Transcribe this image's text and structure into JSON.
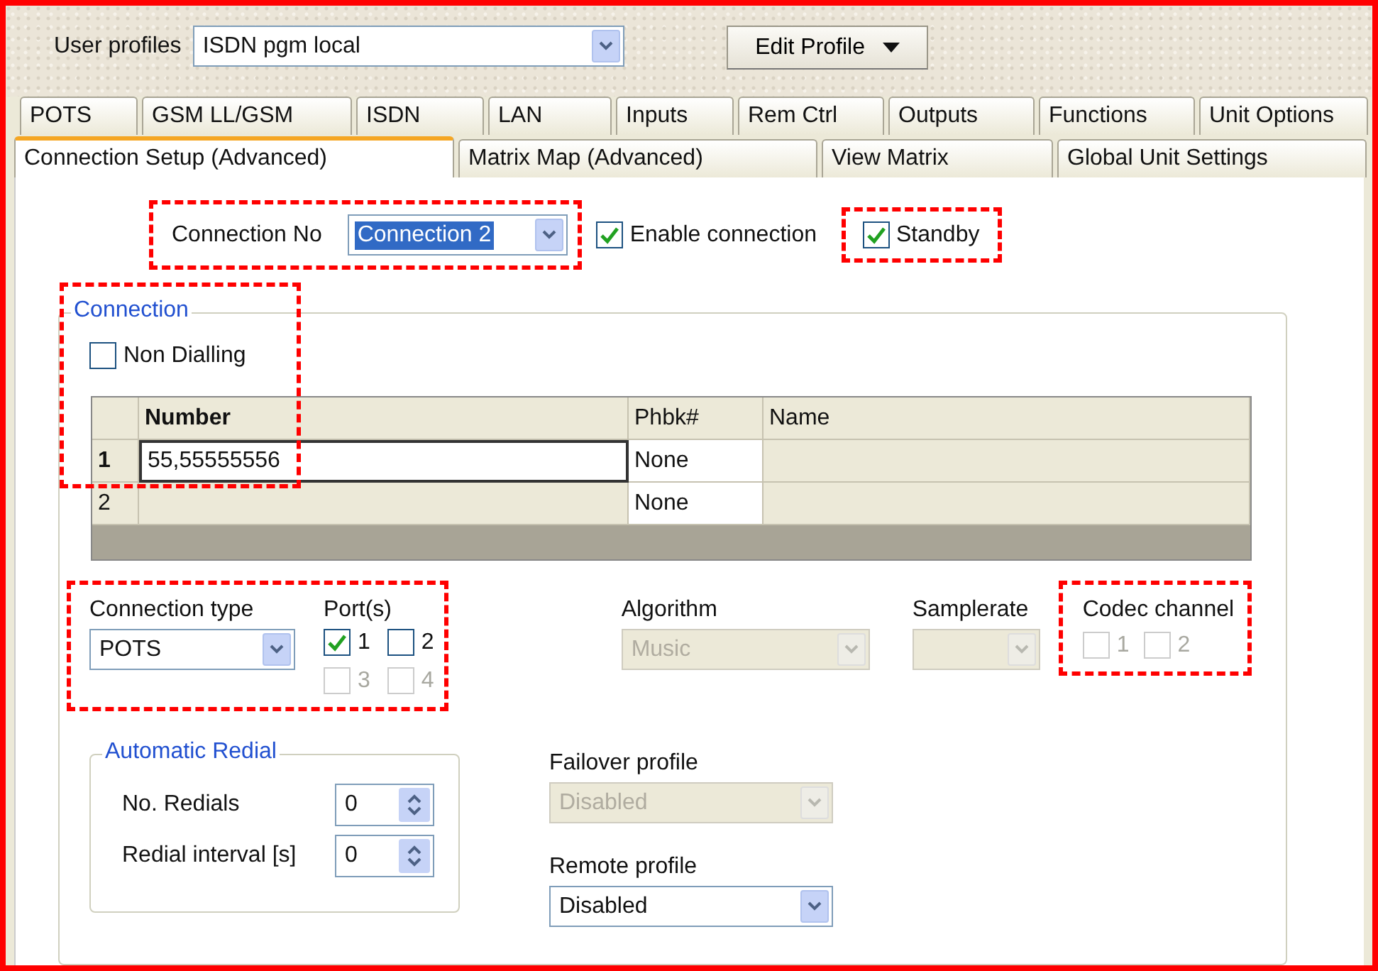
{
  "user_profiles": {
    "label": "User profiles",
    "value": "ISDN pgm local"
  },
  "edit_profile": {
    "label": "Edit Profile"
  },
  "tabs_row_1": [
    {
      "label": "POTS",
      "selected": false
    },
    {
      "label": "GSM LL/GSM",
      "selected": false
    },
    {
      "label": "ISDN",
      "selected": false
    },
    {
      "label": "LAN",
      "selected": false
    },
    {
      "label": "Inputs",
      "selected": false
    },
    {
      "label": "Rem Ctrl",
      "selected": false
    },
    {
      "label": "Outputs",
      "selected": false
    },
    {
      "label": "Functions",
      "selected": false
    },
    {
      "label": "Unit Options",
      "selected": false
    }
  ],
  "tabs_row_2": [
    {
      "label": "Connection Setup (Advanced)",
      "selected": true
    },
    {
      "label": "Matrix Map (Advanced)",
      "selected": false
    },
    {
      "label": "View Matrix",
      "selected": false
    },
    {
      "label": "Global Unit Settings",
      "selected": false
    }
  ],
  "connection_no": {
    "label": "Connection No",
    "value": "Connection 2",
    "highlighted": true
  },
  "enable_connection": {
    "label": "Enable connection",
    "checked": true
  },
  "standby": {
    "label": "Standby",
    "checked": true,
    "highlighted": true
  },
  "connection": {
    "title": "Connection",
    "highlighted": true,
    "non_dialling": {
      "label": "Non Dialling",
      "checked": false
    },
    "table": {
      "columns": [
        "Number",
        "Phbk#",
        "Name"
      ],
      "rows": [
        {
          "index": "1",
          "number": "55,55555556",
          "phbk": "None",
          "selected": true
        },
        {
          "index": "2",
          "phbk": "None",
          "selected": false
        }
      ]
    },
    "connection_type": {
      "label": "Connection type",
      "value": "POTS",
      "highlighted": true
    },
    "ports": {
      "label": "Port(s)",
      "items": [
        {
          "label": "1",
          "checked": true,
          "disabled": false
        },
        {
          "label": "2",
          "checked": false,
          "disabled": false
        },
        {
          "label": "3",
          "checked": false,
          "disabled": true
        },
        {
          "label": "4",
          "checked": false,
          "disabled": true
        }
      ]
    },
    "algorithm": {
      "label": "Algorithm",
      "value": "Music",
      "disabled": true
    },
    "samplerate": {
      "label": "Samplerate",
      "disabled": true
    },
    "codec_channel": {
      "label": "Codec channel",
      "highlighted": true,
      "items": [
        {
          "label": "1",
          "checked": false,
          "disabled": true
        },
        {
          "label": "2",
          "checked": false,
          "disabled": true
        }
      ]
    },
    "automatic_redial": {
      "title": "Automatic Redial",
      "fields": [
        {
          "label": "No. Redials",
          "value": "0"
        },
        {
          "label": "Redial interval [s]",
          "value": "0"
        }
      ]
    },
    "failover_profile": {
      "label": "Failover profile",
      "value": "Disabled",
      "disabled": true
    },
    "remote_profile": {
      "label": "Remote profile",
      "value": "Disabled",
      "disabled": false
    }
  }
}
